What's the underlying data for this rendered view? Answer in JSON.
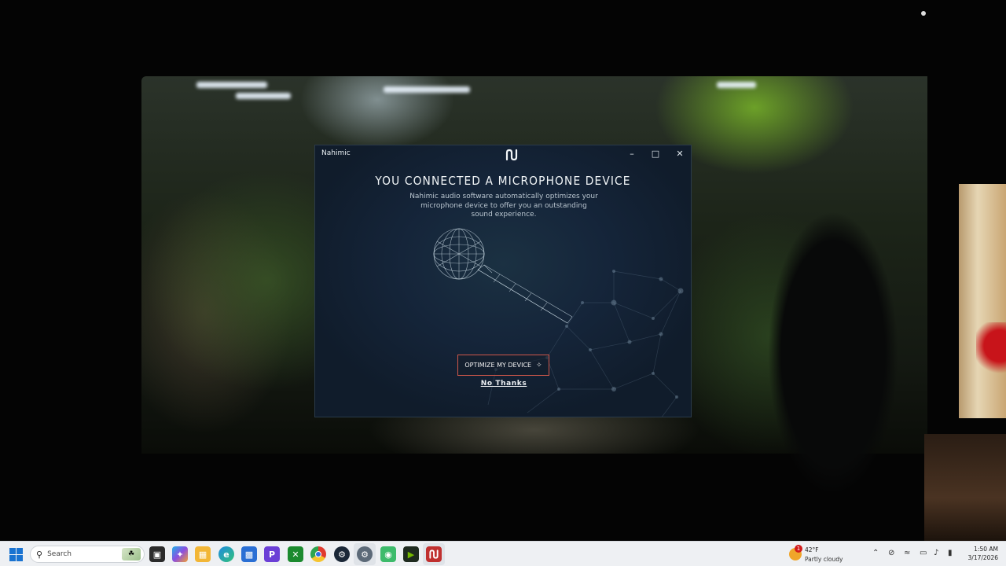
{
  "window": {
    "title": "Nahimic",
    "headline": "YOU CONNECTED A MICROPHONE DEVICE",
    "description": "Nahimic audio software automatically optimizes your microphone device to offer you an outstanding sound experience.",
    "optimize_label": "OPTIMIZE MY DEVICE",
    "no_thanks_label": "No Thanks",
    "accent_color": "#d0574a"
  },
  "taskbar": {
    "search_placeholder": "Search",
    "apps": [
      "task-view-icon",
      "copilot-icon",
      "file-explorer-icon",
      "edge-icon",
      "store-icon",
      "proton-icon",
      "xbox-icon",
      "chrome-icon",
      "steam-icon",
      "settings-icon",
      "android-icon",
      "nvidia-icon",
      "nahimic-icon"
    ],
    "weather": {
      "temperature": "42°F",
      "condition": "Partly cloudy",
      "badge": "1"
    },
    "clock": {
      "time": "1:50 AM",
      "date": "3/17/2026"
    }
  }
}
